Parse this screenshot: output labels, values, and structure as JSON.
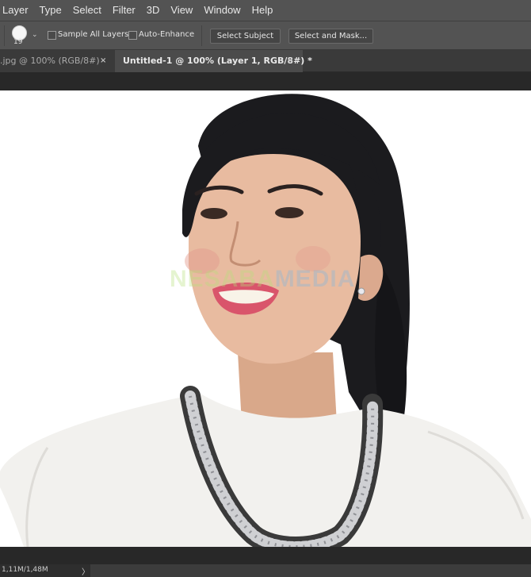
{
  "menu": {
    "items": [
      "Layer",
      "Type",
      "Select",
      "Filter",
      "3D",
      "View",
      "Window",
      "Help"
    ]
  },
  "options": {
    "brush_size": "19",
    "sample_all_layers_label": "Sample All Layers",
    "sample_all_layers_checked": false,
    "auto_enhance_label": "Auto-Enhance",
    "auto_enhance_checked": false,
    "select_subject_label": "Select Subject",
    "select_and_mask_label": "Select and Mask..."
  },
  "tabs": [
    {
      "label": ".jpg @ 100% (RGB/8#)",
      "close": "×",
      "active": false
    },
    {
      "label": "Untitled-1 @ 100% (Layer 1, RGB/8#) *",
      "close": "×",
      "active": true
    }
  ],
  "canvas": {
    "watermark_part1": "NESABA",
    "watermark_part2": "MEDIA"
  },
  "status": {
    "doc_size": "1,11M/1,48M",
    "arrow": "〉"
  },
  "colors": {
    "chrome": "#535353",
    "workspace": "#282828",
    "canvas_bg": "#ffffff"
  }
}
